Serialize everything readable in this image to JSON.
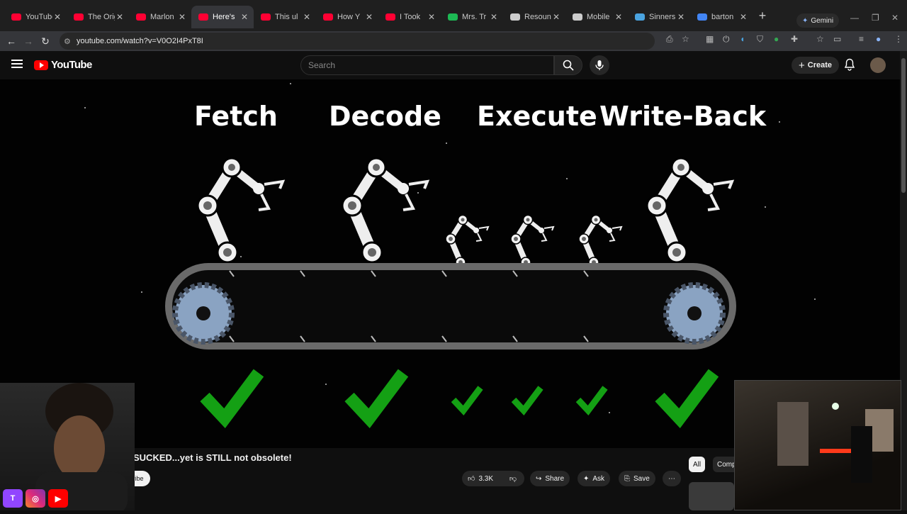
{
  "browser": {
    "tabs": [
      {
        "title": "YouTube",
        "favicon_color": "#ff0033"
      },
      {
        "title": "The Original",
        "favicon_color": "#ff0033"
      },
      {
        "title": "Marlon",
        "favicon_color": "#ff0033"
      },
      {
        "title": "Here's",
        "favicon_color": "#ff0033",
        "active": true
      },
      {
        "title": "This ul",
        "favicon_color": "#ff0033"
      },
      {
        "title": "How Y",
        "favicon_color": "#ff0033"
      },
      {
        "title": "I Took",
        "favicon_color": "#ff0033"
      },
      {
        "title": "Mrs. Tr",
        "favicon_color": "#1db954"
      },
      {
        "title": "Resoun",
        "favicon_color": "#cccccc"
      },
      {
        "title": "Mobile",
        "favicon_color": "#cccccc"
      },
      {
        "title": "Sinners",
        "favicon_color": "#4aa3df"
      },
      {
        "title": "barton",
        "favicon_color": "#4285f4"
      }
    ],
    "gemini_label": "Gemini",
    "url": "youtube.com/watch?v=V0O2I4PxT8I"
  },
  "youtube": {
    "logo_text": "YouTube",
    "search_placeholder": "Search",
    "create_label": "Create"
  },
  "video": {
    "stages": [
      "Fetch",
      "Decode",
      "Execute",
      "Write-Back"
    ]
  },
  "below": {
    "title_fragment": "SUCKED...yet is STILL not obsolete!",
    "subscribe_fragment": "ribe",
    "likes": "3.3K",
    "share_label": "Share",
    "ask_label": "Ask",
    "save_label": "Save",
    "chips": [
      "All",
      "Comp"
    ]
  },
  "icons": {
    "back": "arrow-left-icon",
    "forward": "arrow-right-icon",
    "reload": "reload-icon",
    "search": "search-icon",
    "mic": "mic-icon",
    "bell": "bell-icon",
    "like": "thumbs-up-icon",
    "dislike": "thumbs-down-icon",
    "more": "more-horizontal-icon"
  }
}
